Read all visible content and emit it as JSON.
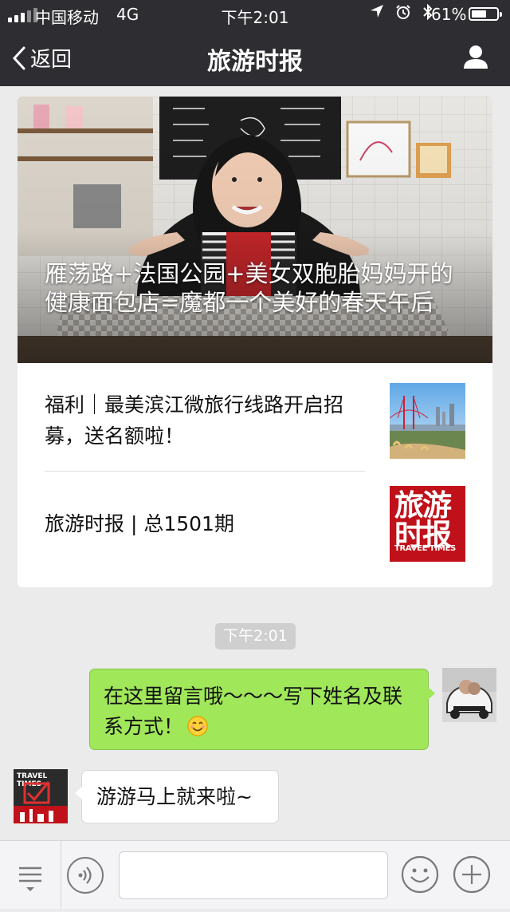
{
  "status_bar": {
    "carrier": "中国移动",
    "network": "4G",
    "time": "下午2:01",
    "battery_percent": "61%",
    "battery_level": 0.61,
    "icons": [
      "location-arrow-icon",
      "alarm-icon",
      "bluetooth-icon"
    ]
  },
  "nav": {
    "back_label": "返回",
    "title": "旅游时报",
    "profile_icon": "person-icon"
  },
  "article": {
    "hero_title": "雁荡路+法国公园+美女双胞胎妈妈开的健康面包店=魔都一个美好的春天午后",
    "items": [
      {
        "title": "福利｜最美滨江微旅行线路开启招募，送名额啦！"
      },
      {
        "title": "旅游时报 | 总1501期"
      }
    ],
    "logo": {
      "cn_line1": "旅游",
      "cn_line2": "时报",
      "en": "TRAVEL TIMES"
    }
  },
  "chat": {
    "timestamp": "下午2:01",
    "messages": [
      {
        "side": "out",
        "text": "在这里留言哦～～～写下姓名及联系方式！"
      },
      {
        "side": "in",
        "text": "游游马上就来啦~"
      }
    ],
    "bot_avatar_label": "TRAVEL TIMES"
  },
  "input_bar": {
    "menu_icon": "menu-list-icon",
    "voice_icon": "voice-icon",
    "emoji_icon": "emoji-icon",
    "plus_icon": "plus-icon",
    "input_value": ""
  },
  "colors": {
    "nav_bg": "#2e2e32",
    "chat_bg": "#ebebeb",
    "out_bubble": "#a0e75a",
    "brand_red": "#c0111a"
  }
}
